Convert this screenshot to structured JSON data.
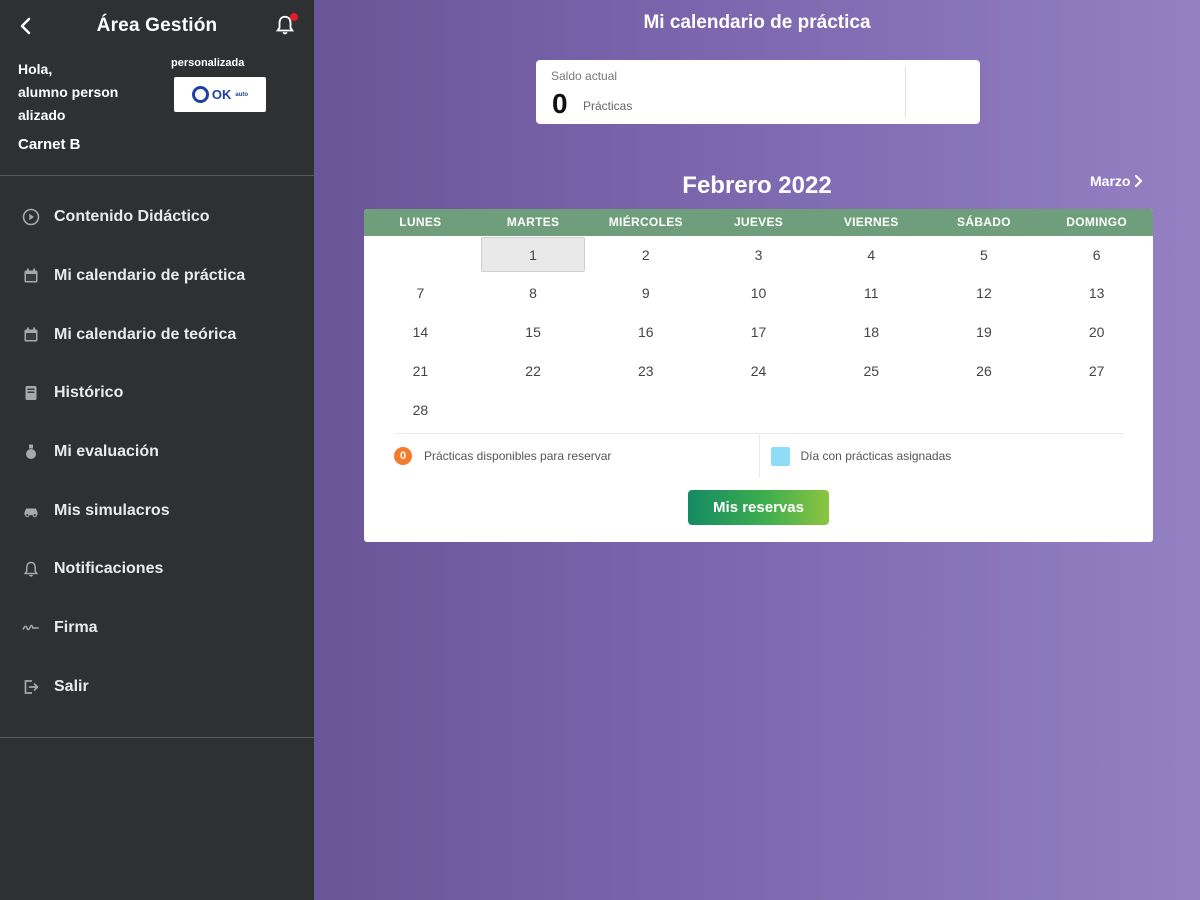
{
  "sidebar": {
    "title": "Área Gestión",
    "greeting": "Hola,",
    "user_name": "alumno personalizado",
    "user_name_line1": "alumno person",
    "user_name_line2": "alizado",
    "license": "Carnet B",
    "school_label": "personalizada",
    "logo_text": "OK",
    "logo_small": "auto",
    "items": [
      {
        "label": "Contenido Didáctico",
        "icon": "play-circle-icon"
      },
      {
        "label": "Mi calendario de práctica",
        "icon": "calendar-icon"
      },
      {
        "label": "Mi calendario de teórica",
        "icon": "calendar-icon"
      },
      {
        "label": "Histórico",
        "icon": "book-icon"
      },
      {
        "label": "Mi evaluación",
        "icon": "medal-icon"
      },
      {
        "label": "Mis simulacros",
        "icon": "car-icon"
      },
      {
        "label": "Notificaciones",
        "icon": "bell-icon"
      },
      {
        "label": "Firma",
        "icon": "signature-icon"
      },
      {
        "label": "Salir",
        "icon": "logout-icon"
      }
    ]
  },
  "main": {
    "title": "Mi calendario de práctica",
    "balance": {
      "label": "Saldo actual",
      "value": "0",
      "unit": "Prácticas"
    },
    "calendar": {
      "month": "Febrero 2022",
      "next_month": "Marzo",
      "weekdays": [
        "LUNES",
        "MARTES",
        "MIÉRCOLES",
        "JUEVES",
        "VIERNES",
        "SÁBADO",
        "DOMINGO"
      ],
      "weeks": [
        [
          "",
          "1",
          "2",
          "3",
          "4",
          "5",
          "6"
        ],
        [
          "7",
          "8",
          "9",
          "10",
          "11",
          "12",
          "13"
        ],
        [
          "14",
          "15",
          "16",
          "17",
          "18",
          "19",
          "20"
        ],
        [
          "21",
          "22",
          "23",
          "24",
          "25",
          "26",
          "27"
        ],
        [
          "28",
          "",
          "",
          "",
          "",
          "",
          ""
        ]
      ],
      "today": "1"
    },
    "legend": {
      "available_count": "0",
      "available_label": "Prácticas disponibles para reservar",
      "assigned_label": "Día con prácticas asignadas"
    },
    "reservations_button": "Mis reservas"
  },
  "colors": {
    "sidebar_bg": "#2f3032",
    "header_green": "#6e9e7b",
    "available_orange": "#f37b2b",
    "assigned_blue": "#8fdcf7",
    "notification_red": "#e21b2d"
  }
}
